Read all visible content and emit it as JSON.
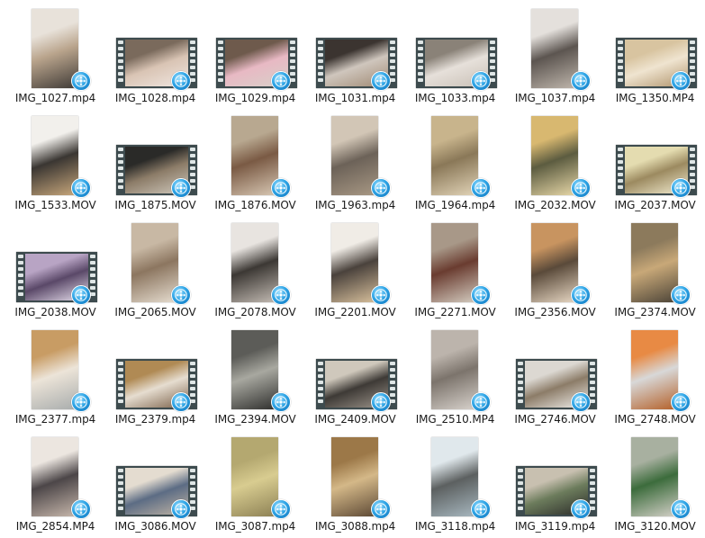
{
  "view": {
    "name": "file-thumbnail-grid",
    "columns": 7
  },
  "files": [
    {
      "name": "IMG_1027.mp4",
      "orientation": "portrait",
      "colors": [
        "#e8e2da",
        "#b9a48c",
        "#3f3a36"
      ]
    },
    {
      "name": "IMG_1028.mp4",
      "orientation": "landscape",
      "colors": [
        "#7a6a5c",
        "#d9c4b4",
        "#f0e6e0"
      ]
    },
    {
      "name": "IMG_1029.mp4",
      "orientation": "landscape",
      "colors": [
        "#6e5a4c",
        "#e8b9c4",
        "#d8d0c8"
      ]
    },
    {
      "name": "IMG_1031.mp4",
      "orientation": "landscape",
      "colors": [
        "#3b3430",
        "#cfc6bd",
        "#a08a74"
      ]
    },
    {
      "name": "IMG_1033.mp4",
      "orientation": "landscape",
      "colors": [
        "#8a8278",
        "#e6e0da",
        "#c9c0b6"
      ]
    },
    {
      "name": "IMG_1037.mp4",
      "orientation": "portrait",
      "colors": [
        "#e4e0dc",
        "#5c5550",
        "#bfb6ac"
      ]
    },
    {
      "name": "IMG_1350.MP4",
      "orientation": "landscape",
      "colors": [
        "#d8c4a0",
        "#efe4d0",
        "#b0946c"
      ]
    },
    {
      "name": "IMG_1533.MOV",
      "orientation": "portrait",
      "colors": [
        "#f2f0ec",
        "#3a3632",
        "#c9a87c"
      ]
    },
    {
      "name": "IMG_1875.MOV",
      "orientation": "landscape",
      "colors": [
        "#2a2a28",
        "#8c7c68",
        "#cfc8bc"
      ]
    },
    {
      "name": "IMG_1876.MOV",
      "orientation": "portrait",
      "colors": [
        "#b8a890",
        "#7a5a44",
        "#d8c8b4"
      ]
    },
    {
      "name": "IMG_1963.mp4",
      "orientation": "portrait",
      "colors": [
        "#d2c6b6",
        "#6c6258",
        "#a89884"
      ]
    },
    {
      "name": "IMG_1964.mp4",
      "orientation": "portrait",
      "colors": [
        "#c8b48c",
        "#8a7858",
        "#e2d4b8"
      ]
    },
    {
      "name": "IMG_2032.MOV",
      "orientation": "portrait",
      "colors": [
        "#d8b870",
        "#5c5c40",
        "#e8d8a8"
      ]
    },
    {
      "name": "IMG_2037.MOV",
      "orientation": "landscape",
      "colors": [
        "#e4dcb0",
        "#9c8a60",
        "#f2ecd0"
      ]
    },
    {
      "name": "IMG_2038.MOV",
      "orientation": "landscape",
      "colors": [
        "#b8a4c4",
        "#5a4868",
        "#e8e0ee"
      ]
    },
    {
      "name": "IMG_2065.MOV",
      "orientation": "portrait",
      "colors": [
        "#c8b8a4",
        "#8c7660",
        "#e6ddd0"
      ]
    },
    {
      "name": "IMG_2078.MOV",
      "orientation": "portrait",
      "colors": [
        "#e8e4e0",
        "#3c3834",
        "#c4bcb4"
      ]
    },
    {
      "name": "IMG_2201.MOV",
      "orientation": "portrait",
      "colors": [
        "#f0ece6",
        "#4a423c",
        "#d8c09c"
      ]
    },
    {
      "name": "IMG_2271.MOV",
      "orientation": "portrait",
      "colors": [
        "#a89888",
        "#6a3c30",
        "#d4ccc0"
      ]
    },
    {
      "name": "IMG_2356.MOV",
      "orientation": "portrait",
      "colors": [
        "#c89460",
        "#5a4a3a",
        "#e8d8c4"
      ]
    },
    {
      "name": "IMG_2374.MOV",
      "orientation": "portrait",
      "colors": [
        "#8c7a5c",
        "#c8a878",
        "#4c4438"
      ]
    },
    {
      "name": "IMG_2377.mp4",
      "orientation": "portrait",
      "colors": [
        "#c89c64",
        "#ece4d8",
        "#a8acac"
      ]
    },
    {
      "name": "IMG_2379.mp4",
      "orientation": "landscape",
      "colors": [
        "#b08a54",
        "#e6ddd0",
        "#7a6048"
      ]
    },
    {
      "name": "IMG_2394.MOV",
      "orientation": "portrait",
      "colors": [
        "#5c5c58",
        "#a8a8a0",
        "#2e2e2c"
      ]
    },
    {
      "name": "IMG_2409.MOV",
      "orientation": "landscape",
      "colors": [
        "#cfc8bc",
        "#3e3a36",
        "#9c948a"
      ]
    },
    {
      "name": "IMG_2510.MP4",
      "orientation": "portrait",
      "colors": [
        "#bcb4ac",
        "#7c746c",
        "#d8d2cc"
      ]
    },
    {
      "name": "IMG_2746.MOV",
      "orientation": "landscape",
      "colors": [
        "#dcd8d2",
        "#8c7c68",
        "#f0eeea"
      ]
    },
    {
      "name": "IMG_2748.MOV",
      "orientation": "portrait",
      "colors": [
        "#e88a44",
        "#d8d8d8",
        "#b46028"
      ]
    },
    {
      "name": "IMG_2854.MP4",
      "orientation": "portrait",
      "colors": [
        "#ece6e0",
        "#4c4648",
        "#c8b8ac"
      ]
    },
    {
      "name": "IMG_3086.MOV",
      "orientation": "landscape",
      "colors": [
        "#e4dcd0",
        "#5c6c84",
        "#c0b4a4"
      ]
    },
    {
      "name": "IMG_3087.mp4",
      "orientation": "portrait",
      "colors": [
        "#b4a870",
        "#d8cc90",
        "#8c8054"
      ]
    },
    {
      "name": "IMG_3088.mp4",
      "orientation": "portrait",
      "colors": [
        "#9c7848",
        "#d4b888",
        "#5c4834"
      ]
    },
    {
      "name": "IMG_3118.mp4",
      "orientation": "portrait",
      "colors": [
        "#e0e8ec",
        "#5c6060",
        "#a8b8c0"
      ]
    },
    {
      "name": "IMG_3119.mp4",
      "orientation": "landscape",
      "colors": [
        "#c8c0b0",
        "#6c7c5c",
        "#2c2c2a"
      ]
    },
    {
      "name": "IMG_3120.MOV",
      "orientation": "portrait",
      "colors": [
        "#a8b0a0",
        "#3c6c3c",
        "#d4d0c8"
      ]
    }
  ]
}
